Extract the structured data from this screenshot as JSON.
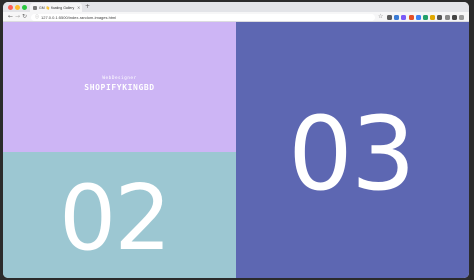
{
  "browser": {
    "tab_title": "GM 👋 floating Gallery",
    "tab_close": "×",
    "new_tab": "+",
    "url": "127.0.0.1:5500/index-random-images.html",
    "back": "←",
    "forward": "→",
    "reload": "↻",
    "lock_icon": "ⓘ",
    "bookmark": "☆",
    "toolbar_colors": [
      "#5b5b5b",
      "#3a7bd5",
      "#7a5af8",
      "#e34f26",
      "#3b82f6",
      "#22a06b",
      "#e0a800",
      "#555555",
      "#888888",
      "#444444",
      "#999999"
    ]
  },
  "panels": {
    "brand": {
      "small_text": "WebDesigner",
      "big_text": "SHOPIFYKINGBD",
      "background": "#cdb5f5"
    },
    "two": {
      "number": "02",
      "background": "#9cc7d2"
    },
    "three": {
      "number": "03",
      "background": "#5d67b2"
    }
  }
}
